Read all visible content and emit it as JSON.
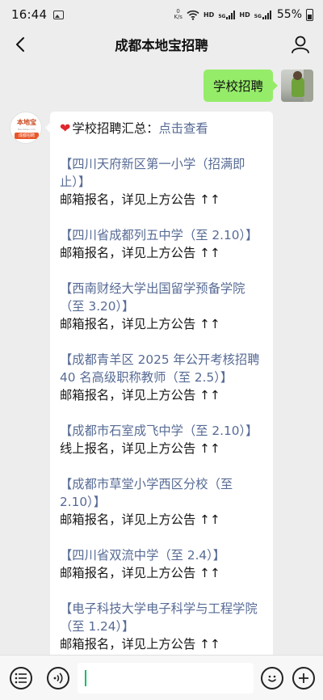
{
  "status_bar": {
    "time": "16:44",
    "net_speed_value": "0",
    "net_speed_unit": "K/s",
    "network_tags": [
      "HD",
      "5G",
      "HD",
      "5G"
    ],
    "battery": "55%"
  },
  "nav": {
    "title": "成都本地宝招聘"
  },
  "bot_avatar": {
    "brand": "本地宝",
    "domain": "Bendibao.com",
    "band": "成都招聘"
  },
  "outgoing_message": "学校招聘",
  "incoming": {
    "heading": "学校招聘汇总：",
    "heading_link": "点击查看",
    "items": [
      {
        "school": "【四川天府新区第一小学（招满即止）】",
        "note": "邮箱报名，详见上方公告 ↑↑"
      },
      {
        "school": "【四川省成都列五中学（至 2.10）】",
        "note": "邮箱报名，详见上方公告 ↑↑"
      },
      {
        "school": "【西南财经大学出国留学预备学院（至 3.20）】",
        "note": "邮箱报名，详见上方公告 ↑↑"
      },
      {
        "school": "【成都青羊区 2025 年公开考核招聘 40 名高级职称教师（至 2.5）】",
        "note": "邮箱报名，详见上方公告 ↑↑"
      },
      {
        "school": "【成都市石室成飞中学（至 2.10）】",
        "note": "线上报名，详见上方公告 ↑↑"
      },
      {
        "school": "【成都市草堂小学西区分校（至 2.10）】",
        "note": "邮箱报名，详见上方公告 ↑↑"
      },
      {
        "school": "【四川省双流中学（至 2.4）】",
        "note": "邮箱报名，详见上方公告 ↑↑"
      },
      {
        "school": "【电子科技大学电子科学与工程学院（至 1.24）】",
        "note": "邮箱报名，详见上方公告 ↑↑"
      }
    ]
  },
  "input_bar": {
    "value": ""
  },
  "colors": {
    "outgoing_bubble": "#95ec69",
    "link": "#576b95",
    "background": "#ededed",
    "caret": "#07c160"
  }
}
